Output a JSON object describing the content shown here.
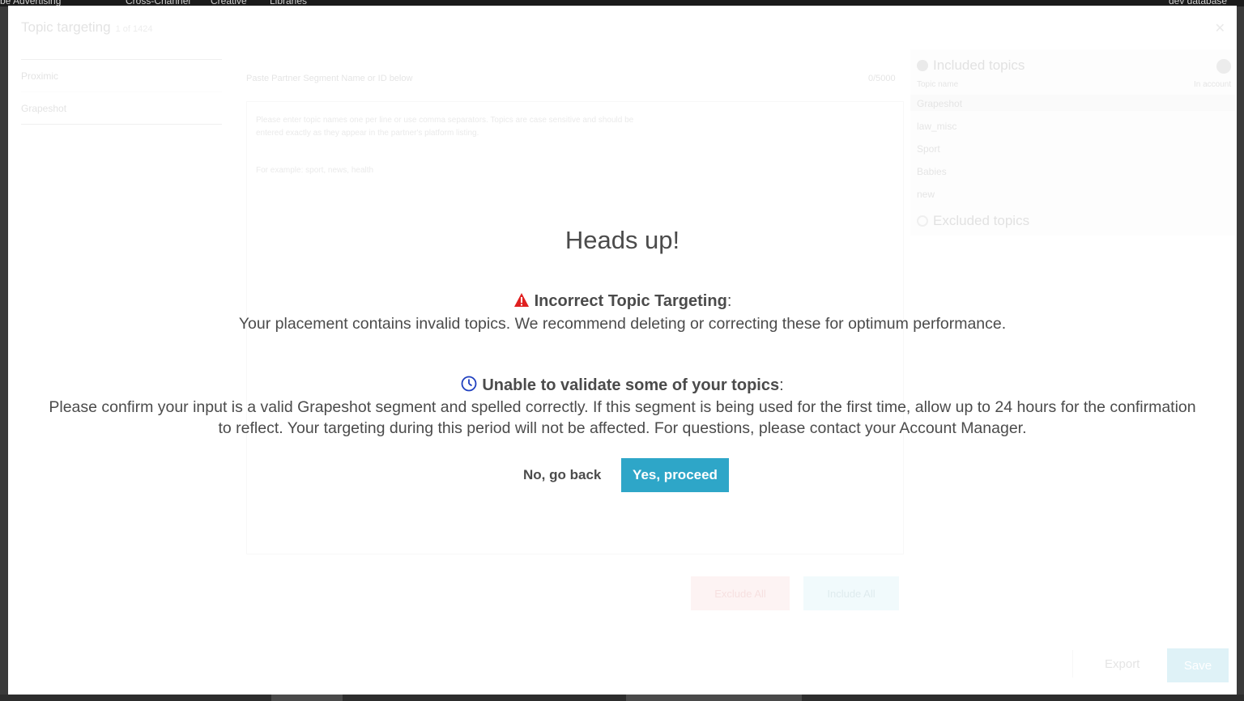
{
  "appbar": {
    "brand": "be Advertising",
    "nav": [
      "Cross-Channel",
      "Creative",
      "Libraries"
    ],
    "env": "dev database"
  },
  "dialog": {
    "title": "Topic targeting",
    "subtitle": "1 of 1424",
    "nav_items": [
      "Proximic",
      "Grapeshot"
    ],
    "input_label": "Paste Partner Segment Name or ID below",
    "count": "0/5000",
    "help_text": "Please enter topic names one per line or use comma separators. Topics are case sensitive and should be entered exactly as they appear in the partner's platform listing.",
    "example": "For example: sport, news, health",
    "exclude_all": "Exclude All",
    "include_all": "Include All",
    "included_heading": "Included topics",
    "included_sub": "Topic name",
    "included_count_label": "In account",
    "included_items": [
      "Grapeshot",
      "law_misc",
      "Sport",
      "Babies",
      "new"
    ],
    "excluded_heading": "Excluded topics",
    "export": "Export",
    "save": "Save"
  },
  "confirm": {
    "title": "Heads up!",
    "warning_heading": "Incorrect Topic Targeting",
    "warning_body": "Your placement contains invalid topics. We recommend deleting or correcting these for optimum performance.",
    "validate_heading": "Unable to validate some of your topics",
    "validate_body_line1": "Please confirm your input is a valid Grapeshot segment and spelled correctly. If this segment is being used for the first time, allow up to 24 hours for the confirmation",
    "validate_body_line2": "to reflect. Your targeting during this period will not be affected. For questions, please contact your Account Manager.",
    "no_button": "No, go back",
    "yes_button": "Yes, proceed",
    "colors": {
      "warning": "#e02020",
      "clock": "#1f3fbf",
      "primary": "#2ea6c8"
    },
    "icons": {
      "warning": "warning-triangle-icon",
      "clock": "clock-icon"
    }
  }
}
